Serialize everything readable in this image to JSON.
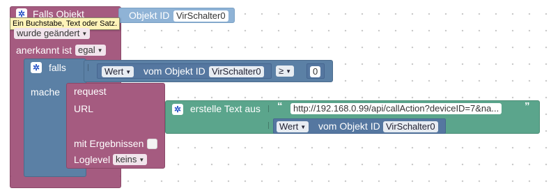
{
  "trigger": {
    "title": "Falls Objekt",
    "object_label": "Objekt ID",
    "object_id": "VirSchalter0",
    "tooltip": "Ein Buchstabe, Text oder Satz.",
    "event_dropdown": "wurde geändert",
    "ack_label": "anerkannt ist",
    "ack_dropdown": "egal"
  },
  "if_block": {
    "label": "falls",
    "do_label": "mache",
    "compare": {
      "value_dropdown": "Wert",
      "from_label": "vom Objekt ID",
      "object_id": "VirSchalter0",
      "operator": "≥",
      "number": "0"
    }
  },
  "request": {
    "title": "request",
    "url_label": "URL",
    "with_results_label": "mit Ergebnissen",
    "loglevel_label": "Loglevel",
    "loglevel_dropdown": "keins"
  },
  "create_text": {
    "label": "erstelle Text aus",
    "open_quote": "“",
    "close_quote": "”",
    "text": "http://192.168.0.99/api/callAction?deviceID=7&na...",
    "value_dropdown": "Wert",
    "from_label": "vom Objekt ID",
    "object_id": "VirSchalter0"
  },
  "icons": {
    "gear": "gear-icon",
    "dropdown_arrow": "dropdown-arrow-icon"
  },
  "colors": {
    "trigger": "#a55b80",
    "logic": "#5b80a5",
    "text": "#5ba58c",
    "workspace_dots": "#c8c8c8"
  }
}
